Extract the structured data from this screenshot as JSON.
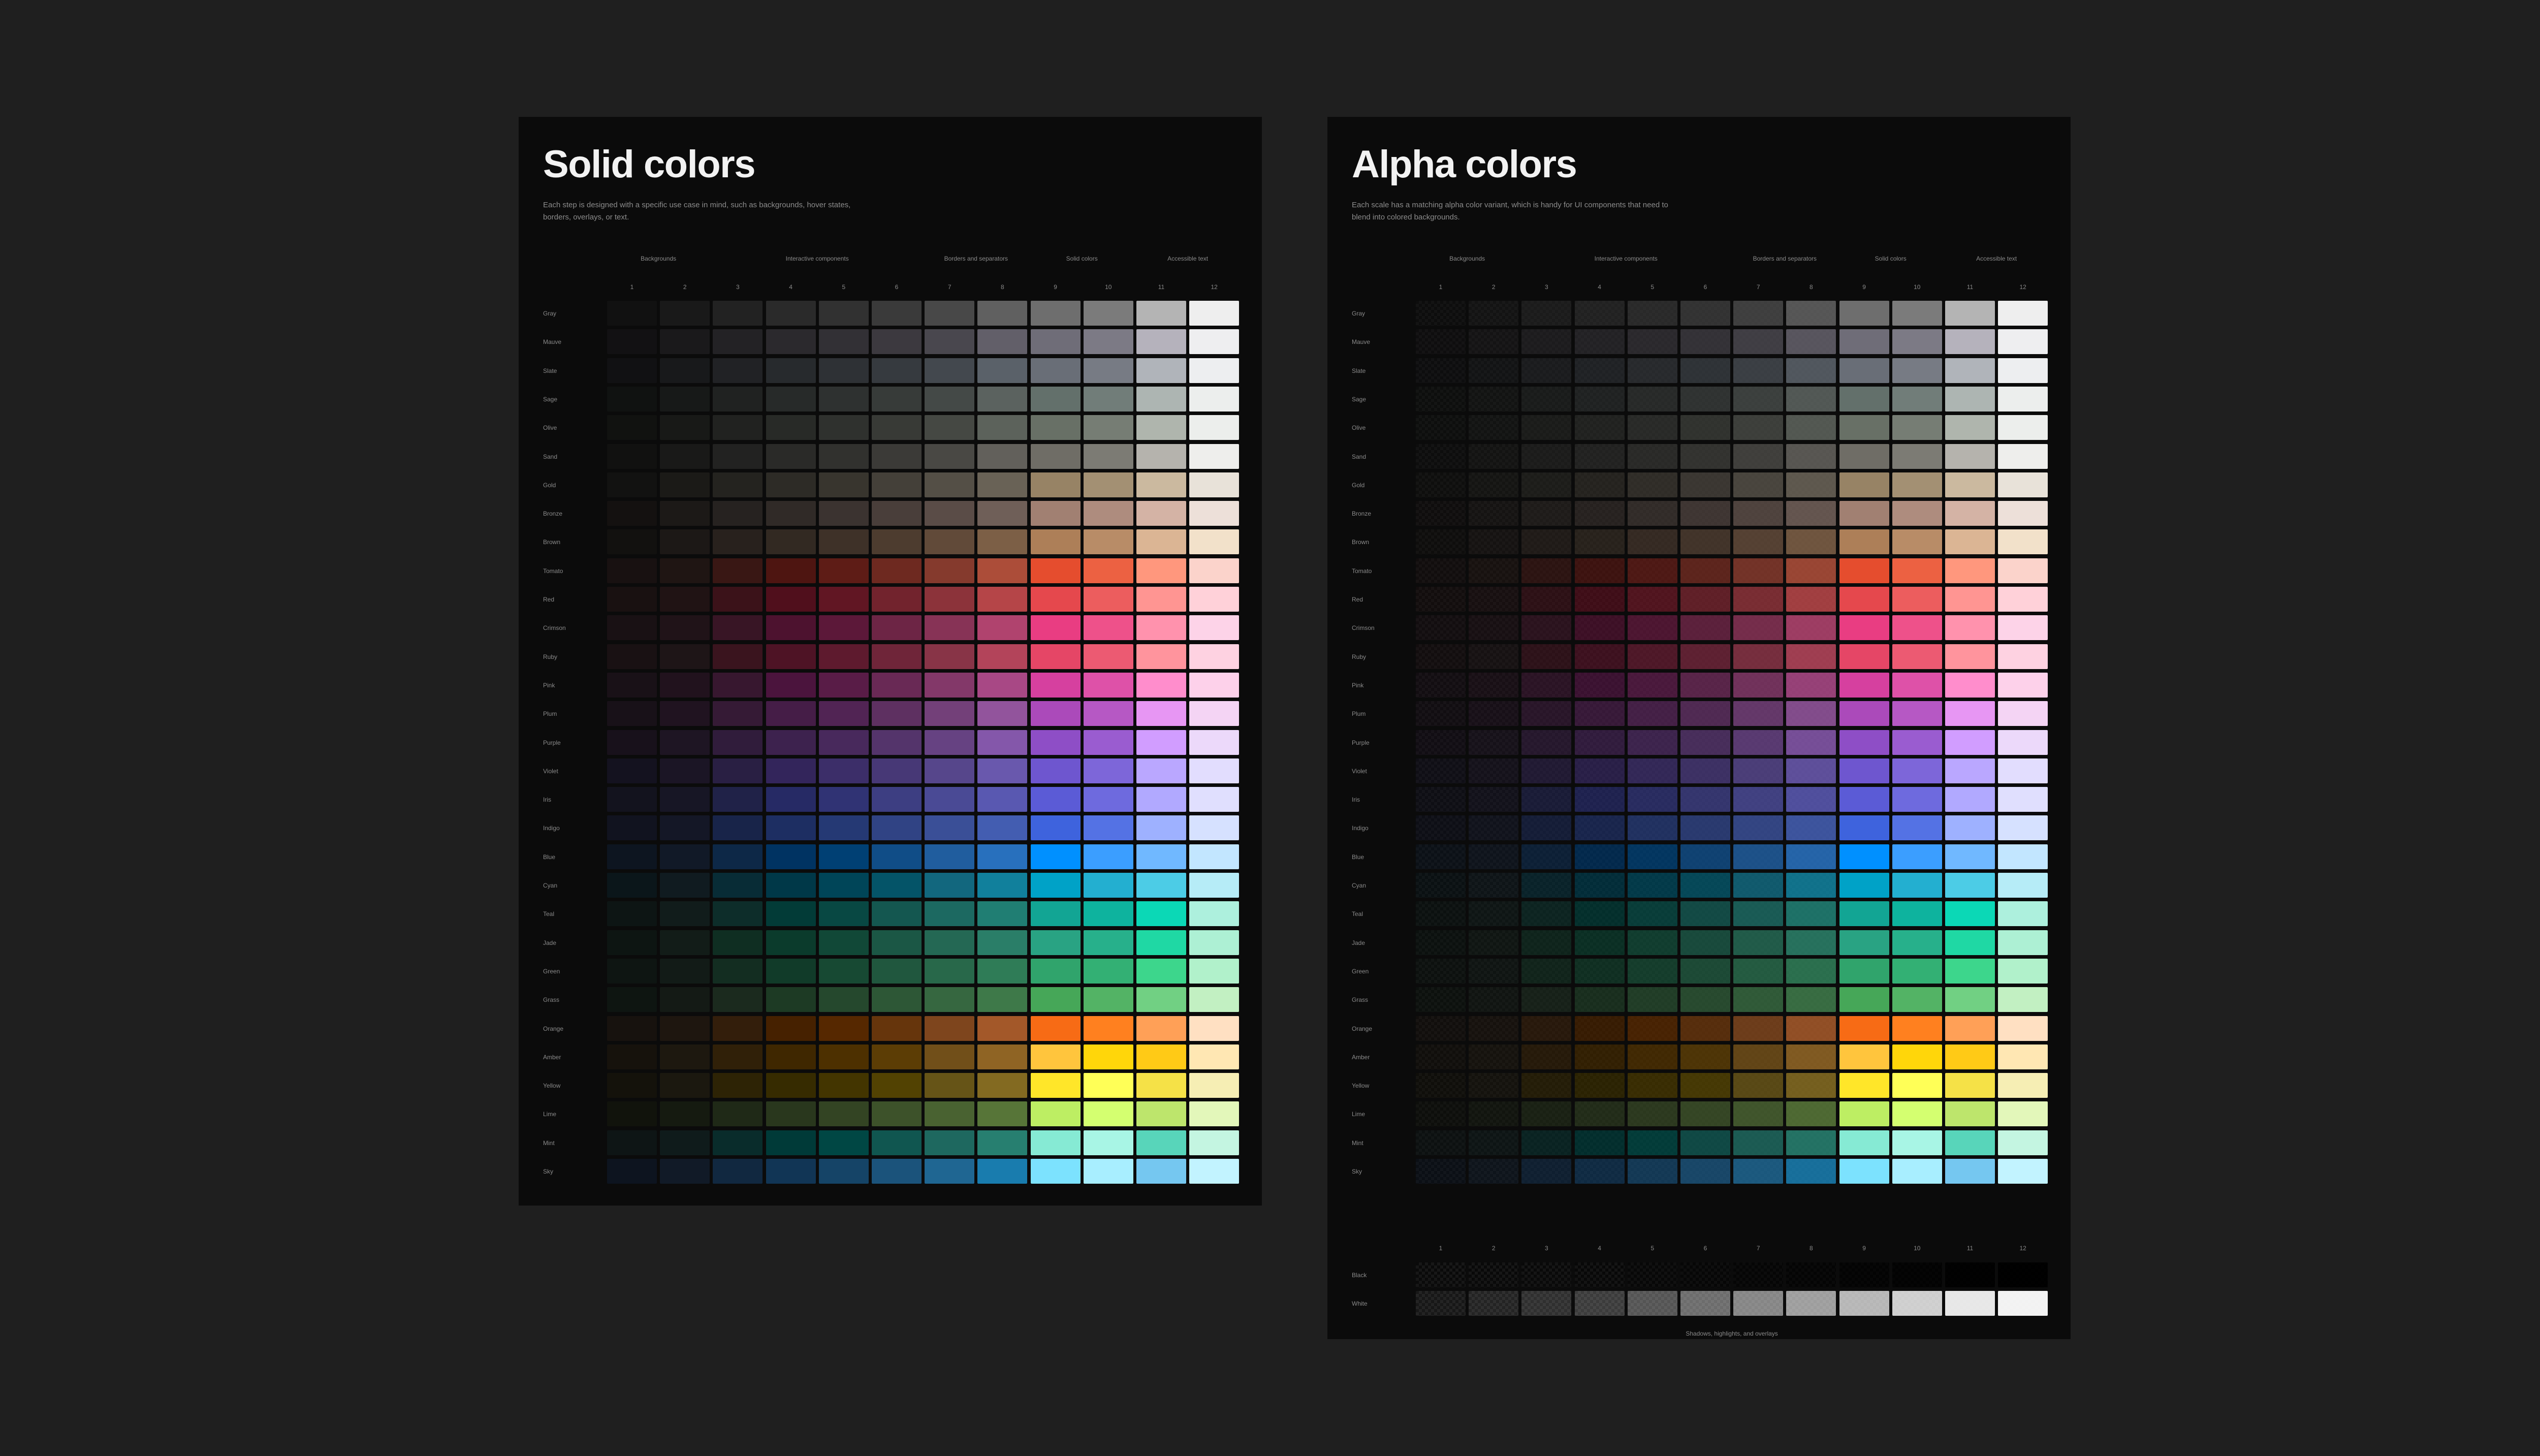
{
  "solid": {
    "title": "Solid colors",
    "subtitle": "Each step is designed with a specific use case in mind, such as backgrounds, hover states, borders, overlays, or text."
  },
  "alpha": {
    "title": "Alpha colors",
    "subtitle": "Each scale has a matching alpha color variant, which is handy for UI components that need to blend into colored backgrounds."
  },
  "groups": [
    "Backgrounds",
    "Interactive components",
    "Borders and separators",
    "Solid colors",
    "Accessible text"
  ],
  "steps": [
    "1",
    "2",
    "3",
    "4",
    "5",
    "6",
    "7",
    "8",
    "9",
    "10",
    "11",
    "12"
  ],
  "scales": [
    {
      "name": "Gray",
      "colors": [
        "#111111",
        "#191919",
        "#222222",
        "#2a2a2a",
        "#313131",
        "#3a3a3a",
        "#484848",
        "#606060",
        "#6e6e6e",
        "#7b7b7b",
        "#b4b4b4",
        "#eeeeee"
      ]
    },
    {
      "name": "Mauve",
      "colors": [
        "#121113",
        "#1a191b",
        "#232225",
        "#2b292d",
        "#323035",
        "#3c393f",
        "#49474e",
        "#625f69",
        "#6f6d78",
        "#7c7a85",
        "#b5b2bc",
        "#eeeef0"
      ]
    },
    {
      "name": "Slate",
      "colors": [
        "#111113",
        "#18191b",
        "#212225",
        "#272a2d",
        "#2e3135",
        "#363a3f",
        "#43484e",
        "#5a6169",
        "#696e77",
        "#777b84",
        "#b0b4ba",
        "#edeef0"
      ]
    },
    {
      "name": "Sage",
      "colors": [
        "#101211",
        "#171918",
        "#202221",
        "#272a29",
        "#2e3130",
        "#373b39",
        "#444947",
        "#5b625f",
        "#63706b",
        "#717d79",
        "#adb5b2",
        "#eceeed"
      ]
    },
    {
      "name": "Olive",
      "colors": [
        "#111210",
        "#181917",
        "#212220",
        "#282a27",
        "#2f312e",
        "#383a36",
        "#454843",
        "#5c625b",
        "#687066",
        "#767d74",
        "#afb5ad",
        "#eceeec"
      ]
    },
    {
      "name": "Sand",
      "colors": [
        "#111110",
        "#191918",
        "#222221",
        "#2a2a28",
        "#31312e",
        "#3b3a37",
        "#494844",
        "#62605b",
        "#6f6d66",
        "#7c7b74",
        "#b5b3ad",
        "#eeeeec"
      ]
    },
    {
      "name": "Gold",
      "colors": [
        "#121211",
        "#1b1a17",
        "#24231f",
        "#2d2b26",
        "#38352e",
        "#444039",
        "#544f46",
        "#696256",
        "#978365",
        "#a39073",
        "#cbb99f",
        "#e8e2d9"
      ]
    },
    {
      "name": "Bronze",
      "colors": [
        "#141110",
        "#1c1917",
        "#262220",
        "#302a27",
        "#3b3330",
        "#493e3a",
        "#5a4c47",
        "#6f5f58",
        "#a18072",
        "#ae8c7e",
        "#d4b3a5",
        "#ede0d9"
      ]
    },
    {
      "name": "Brown",
      "colors": [
        "#12110f",
        "#1c1816",
        "#28211d",
        "#322922",
        "#3e3128",
        "#4d3c2f",
        "#614a39",
        "#7c5f46",
        "#ad7f58",
        "#b88c67",
        "#dbb594",
        "#f2e1ca"
      ]
    },
    {
      "name": "Tomato",
      "colors": [
        "#181111",
        "#1f1513",
        "#391714",
        "#4e1511",
        "#5e1c16",
        "#6e2920",
        "#853a2d",
        "#ac4d39",
        "#e54d2e",
        "#ec6142",
        "#ff977d",
        "#fbd3cb"
      ]
    },
    {
      "name": "Red",
      "colors": [
        "#191111",
        "#201314",
        "#3b1219",
        "#500f1c",
        "#611623",
        "#72232d",
        "#8c333a",
        "#b54548",
        "#e5484d",
        "#ec5d5e",
        "#ff9592",
        "#ffd1d9"
      ]
    },
    {
      "name": "Crimson",
      "colors": [
        "#191114",
        "#201318",
        "#381525",
        "#4d122f",
        "#5c1839",
        "#6d2545",
        "#873356",
        "#b0436e",
        "#e93d82",
        "#ee518a",
        "#ff92ad",
        "#fdd3e8"
      ]
    },
    {
      "name": "Ruby",
      "colors": [
        "#191113",
        "#1e1517",
        "#3a141e",
        "#4e1325",
        "#5e1a2e",
        "#6f2539",
        "#883447",
        "#b3445a",
        "#e54666",
        "#ec5a72",
        "#ff949d",
        "#fed2e1"
      ]
    },
    {
      "name": "Pink",
      "colors": [
        "#191117",
        "#21121d",
        "#37172f",
        "#4b143d",
        "#591c47",
        "#692955",
        "#833869",
        "#a84885",
        "#d6409f",
        "#de51a8",
        "#ff8dcc",
        "#fdd1ea"
      ]
    },
    {
      "name": "Plum",
      "colors": [
        "#181118",
        "#201320",
        "#351a35",
        "#451d47",
        "#512454",
        "#5e3061",
        "#734079",
        "#92549c",
        "#ab4aba",
        "#b658c4",
        "#e796f3",
        "#f4d4f4"
      ]
    },
    {
      "name": "Purple",
      "colors": [
        "#18111b",
        "#1e1523",
        "#301c3b",
        "#3d224e",
        "#48295c",
        "#54346b",
        "#664282",
        "#8457aa",
        "#8e4ec6",
        "#9a5cd0",
        "#d19dff",
        "#ecd9fa"
      ]
    },
    {
      "name": "Violet",
      "colors": [
        "#14121f",
        "#1b1525",
        "#291f43",
        "#33255b",
        "#3c2e69",
        "#473876",
        "#56468b",
        "#6958ad",
        "#6e56cf",
        "#7d66d9",
        "#baa7ff",
        "#e2ddfe"
      ]
    },
    {
      "name": "Iris",
      "colors": [
        "#13131e",
        "#171625",
        "#202248",
        "#262a65",
        "#303374",
        "#3d3e82",
        "#4a4a95",
        "#5958b1",
        "#5b5bd6",
        "#6e6ade",
        "#b1a9ff",
        "#e0dffe"
      ]
    },
    {
      "name": "Indigo",
      "colors": [
        "#11131f",
        "#141726",
        "#182449",
        "#1d2e62",
        "#253974",
        "#304384",
        "#3a4f97",
        "#435db1",
        "#3e63dd",
        "#5472e4",
        "#9eb1ff",
        "#d6e1ff"
      ]
    },
    {
      "name": "Blue",
      "colors": [
        "#0d1520",
        "#111927",
        "#0d2847",
        "#003362",
        "#004074",
        "#104d87",
        "#205d9e",
        "#2870bd",
        "#0090ff",
        "#3b9eff",
        "#70b8ff",
        "#c2e6ff"
      ]
    },
    {
      "name": "Cyan",
      "colors": [
        "#0b161a",
        "#101b20",
        "#082c36",
        "#003848",
        "#004558",
        "#045468",
        "#12677e",
        "#11809c",
        "#00a2c7",
        "#23afd0",
        "#4ccce6",
        "#b6ecf7"
      ]
    },
    {
      "name": "Teal",
      "colors": [
        "#0d1514",
        "#111c1b",
        "#0d2d2a",
        "#023b37",
        "#084843",
        "#145750",
        "#1c6961",
        "#207e73",
        "#12a594",
        "#0eb39e",
        "#0bd8b6",
        "#adf0dd"
      ]
    },
    {
      "name": "Jade",
      "colors": [
        "#0d1512",
        "#121c18",
        "#0f2e22",
        "#0b3b2c",
        "#114837",
        "#1b5745",
        "#246854",
        "#2a7e68",
        "#29a383",
        "#27b08b",
        "#1fd8a4",
        "#adf0d4"
      ]
    },
    {
      "name": "Green",
      "colors": [
        "#0e1512",
        "#121b17",
        "#132d21",
        "#113b29",
        "#174933",
        "#20573e",
        "#28684a",
        "#2f7c57",
        "#30a46c",
        "#33b074",
        "#3dd68c",
        "#b1f1cb"
      ]
    },
    {
      "name": "Grass",
      "colors": [
        "#0e1511",
        "#141a15",
        "#1b2a1e",
        "#1d3a24",
        "#25482d",
        "#2d5736",
        "#366740",
        "#3e7949",
        "#46a758",
        "#53b365",
        "#71d083",
        "#c2f0c2"
      ]
    },
    {
      "name": "Orange",
      "colors": [
        "#17120e",
        "#1e160f",
        "#331e0b",
        "#462100",
        "#562800",
        "#66350c",
        "#7e451d",
        "#a35829",
        "#f76b15",
        "#ff801f",
        "#ffa057",
        "#ffe0c2"
      ]
    },
    {
      "name": "Amber",
      "colors": [
        "#16120c",
        "#1d180f",
        "#302008",
        "#3f2700",
        "#4d3000",
        "#5c3d05",
        "#714f19",
        "#8f6424",
        "#ffc53d",
        "#ffd60a",
        "#ffca16",
        "#ffe7b3"
      ]
    },
    {
      "name": "Yellow",
      "colors": [
        "#14120b",
        "#1b180f",
        "#2d2305",
        "#362b00",
        "#433500",
        "#524202",
        "#665417",
        "#836a21",
        "#ffe629",
        "#ffff57",
        "#f5e147",
        "#f6eeb4"
      ]
    },
    {
      "name": "Lime",
      "colors": [
        "#11130c",
        "#151a10",
        "#1f2917",
        "#29371d",
        "#334423",
        "#3d522a",
        "#496231",
        "#577538",
        "#bdee63",
        "#d4ff70",
        "#bde56c",
        "#e3f7ba"
      ]
    },
    {
      "name": "Mint",
      "colors": [
        "#0e1515",
        "#0f1b1b",
        "#092c2b",
        "#003a38",
        "#004744",
        "#105650",
        "#1e685f",
        "#277f70",
        "#86ead4",
        "#a8f5e5",
        "#58d5ba",
        "#c4f5e1"
      ]
    },
    {
      "name": "Sky",
      "colors": [
        "#0d141f",
        "#111a27",
        "#112840",
        "#113555",
        "#154467",
        "#1b537b",
        "#1f6692",
        "#197cae",
        "#7ce2fe",
        "#a8eeff",
        "#75c7f0",
        "#c2f3ff"
      ]
    }
  ],
  "overlays": {
    "title": "Shadows, highlights, and overlays",
    "rows": [
      {
        "name": "Black",
        "alphas": [
          0.05,
          0.1,
          0.15,
          0.2,
          0.3,
          0.4,
          0.5,
          0.6,
          0.7,
          0.8,
          0.9,
          0.95
        ],
        "base": "#000000"
      },
      {
        "name": "White",
        "alphas": [
          0.05,
          0.1,
          0.15,
          0.2,
          0.3,
          0.4,
          0.5,
          0.6,
          0.7,
          0.8,
          0.9,
          0.95
        ],
        "base": "#ffffff"
      }
    ]
  }
}
